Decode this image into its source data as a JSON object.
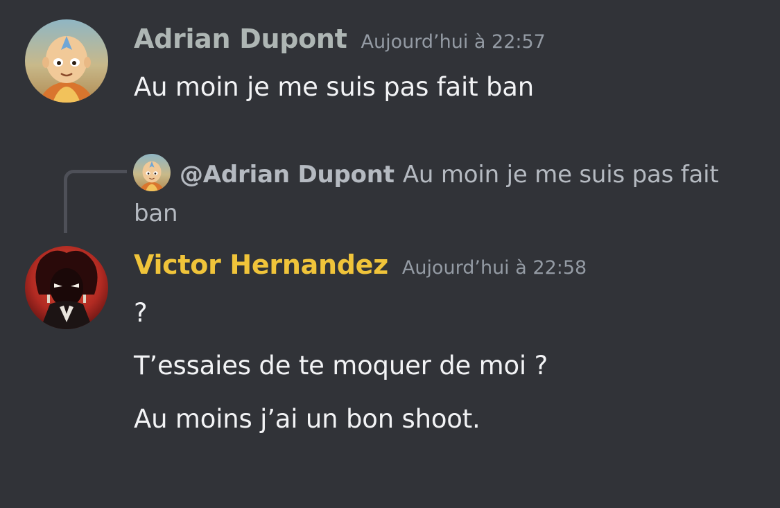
{
  "colors": {
    "background": "#313338",
    "username_adrian": "#aeb6b4",
    "username_victor": "#f0c43a",
    "timestamp": "#949ba4",
    "message_text": "#f2f3f5",
    "reply_spine": "#4e5058"
  },
  "messages": [
    {
      "author": "Adrian Dupont",
      "timestamp": "Aujourd’hui à 22:57",
      "avatar_icon": "aang-avatar-icon",
      "lines": [
        "Au moin je me suis pas fait ban"
      ]
    },
    {
      "reply": {
        "mention": "@Adrian Dupont",
        "excerpt": "Au moin je me suis pas fait ban",
        "avatar_icon": "aang-avatar-icon"
      },
      "author": "Victor Hernandez",
      "timestamp": "Aujourd’hui à 22:58",
      "avatar_icon": "dark-character-avatar-icon",
      "lines": [
        "?",
        "T’essaies de te moquer de moi ?",
        "Au moins j’ai un bon shoot."
      ]
    }
  ]
}
